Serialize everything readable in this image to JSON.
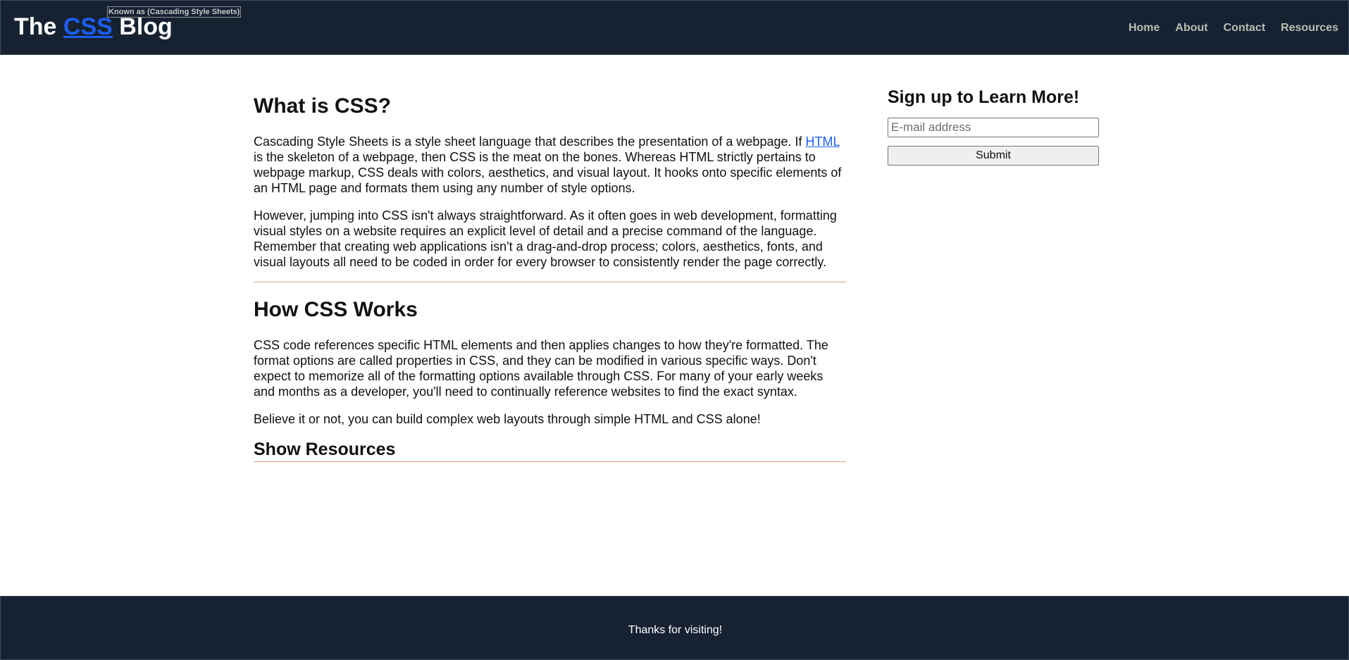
{
  "header": {
    "title_prefix": "The ",
    "title_link": "CSS",
    "title_suffix": " Blog",
    "tooltip": "Known as (Cascading Style Sheets)",
    "nav": [
      "Home",
      "About",
      "Contact",
      "Resources"
    ]
  },
  "article": {
    "section1_title": "What is CSS?",
    "p1_before_link": "Cascading Style Sheets is a style sheet language that describes the presentation of a webpage. If ",
    "p1_link": "HTML",
    "p1_after_link": " is the skeleton of a webpage, then CSS is the meat on the bones. Whereas HTML strictly pertains to webpage markup, CSS deals with colors, aesthetics, and visual layout. It hooks onto specific elements of an HTML page and formats them using any number of style options.",
    "p2": "However, jumping into CSS isn't always straightforward. As it often goes in web development, formatting visual styles on a website requires an explicit level of detail and a precise command of the language. Remember that creating web applications isn't a drag-and-drop process; colors, aesthetics, fonts, and visual layouts all need to be coded in order for every browser to consistently render the page correctly.",
    "section2_title": "How CSS Works",
    "p3": "CSS code references specific HTML elements and then applies changes to how they're formatted. The format options are called properties in CSS, and they can be modified in various specific ways. Don't expect to memorize all of the formatting options available through CSS. For many of your early weeks and months as a developer, you'll need to continually reference websites to find the exact syntax.",
    "p4": "Believe it or not, you can build complex web layouts through simple HTML and CSS alone!",
    "show_resources": "Show Resources"
  },
  "signup": {
    "title": "Sign up to Learn More!",
    "email_placeholder": "E-mail address",
    "submit_label": "Submit"
  },
  "footer": {
    "text": "Thanks for visiting!"
  },
  "colors": {
    "header_bg": "#162232",
    "link": "#1c5ef0",
    "nav_link": "#b9bdb2",
    "divider": "#e0a07a"
  }
}
